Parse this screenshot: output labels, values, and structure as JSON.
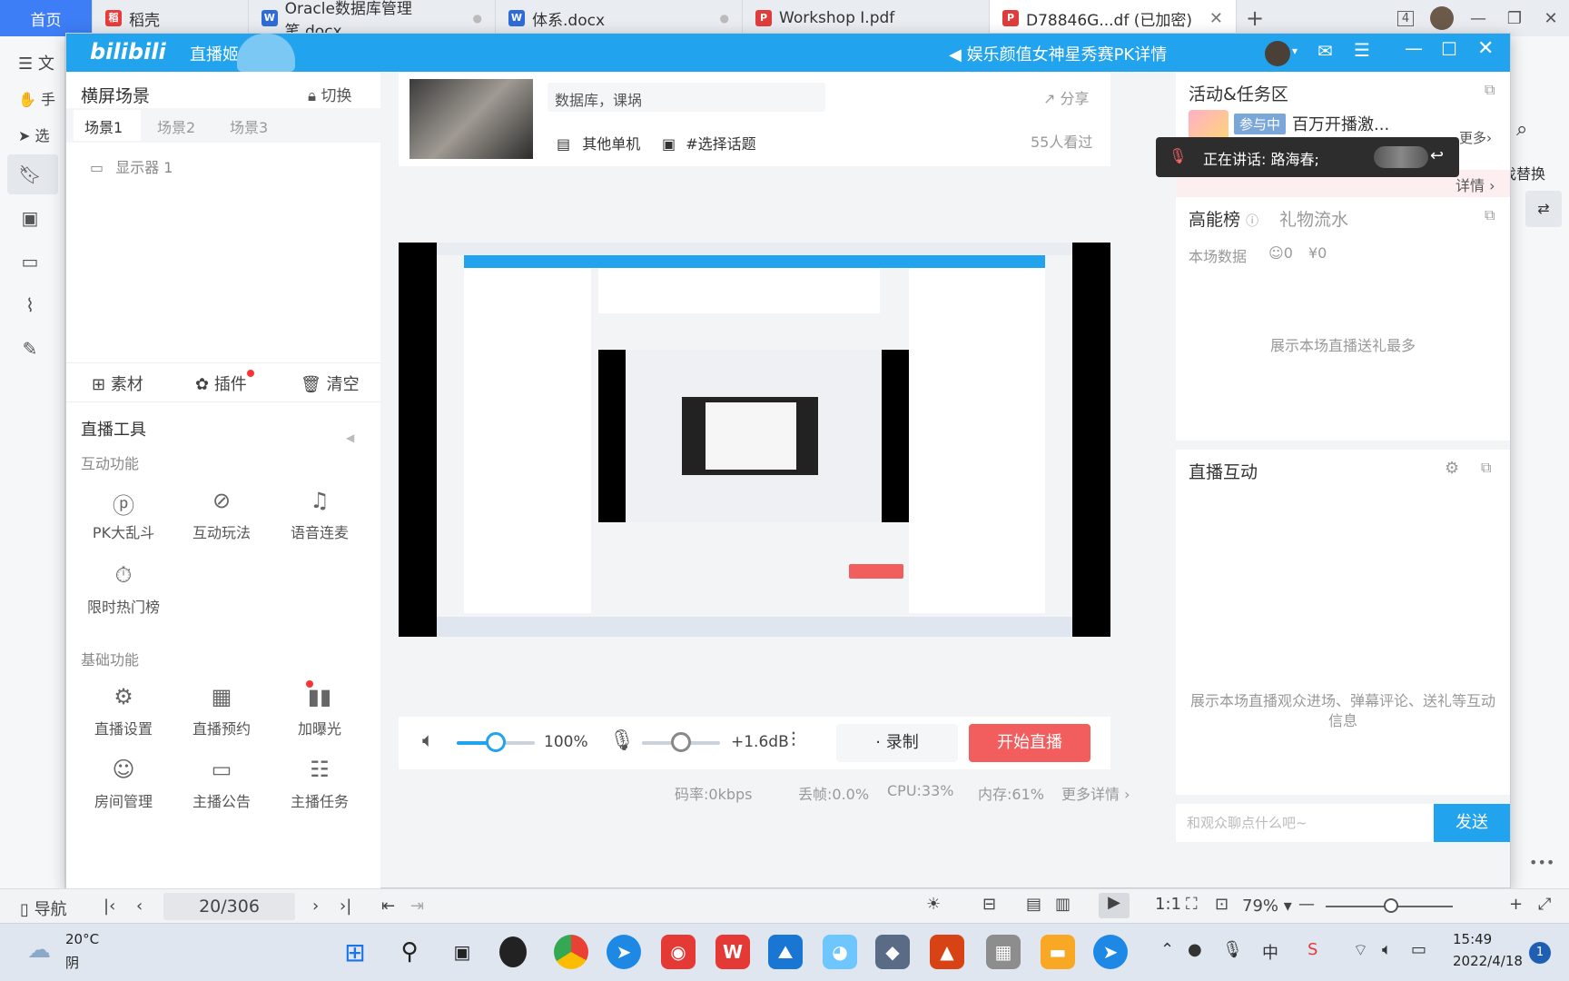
{
  "tabs": {
    "home": "首页",
    "items": [
      {
        "label": "稻壳",
        "icon": "daoke-icon",
        "color": "#e63c3c"
      },
      {
        "label": "Oracle数据库管理笔.docx",
        "icon": "word-icon",
        "color": "#2f6bd8"
      },
      {
        "label": "体系.docx",
        "icon": "word-icon",
        "color": "#2f6bd8"
      },
      {
        "label": "Workshop I.pdf",
        "icon": "pdf-icon",
        "color": "#e03c3c"
      },
      {
        "label": "D78846G...df (已加密)",
        "icon": "pdf-icon",
        "color": "#e03c3c"
      }
    ],
    "add": "+",
    "count_badge": "4"
  },
  "wps_left": {
    "menu": "文",
    "hand": "手",
    "select": "选",
    "replace": "找替换"
  },
  "bili": {
    "logo": "bilibili",
    "app_name": "直播姬",
    "announcement": "娱乐颜值女神星秀赛PK详情",
    "scene_panel": {
      "title": "横屏场景",
      "switch_label": "切换",
      "scenes": [
        "场景1",
        "场景2",
        "场景3"
      ],
      "source": "显示器 1",
      "actions": {
        "material": "素材",
        "plugin": "插件",
        "clear": "清空"
      }
    },
    "tools": {
      "title": "直播工具",
      "interactive_heading": "互动功能",
      "interactive": [
        "PK大乱斗",
        "互动玩法",
        "语音连麦",
        "限时热门榜"
      ],
      "basic_heading": "基础功能",
      "basic": [
        "直播设置",
        "直播预约",
        "加曝光",
        "房间管理",
        "主播公告",
        "主播任务"
      ]
    },
    "room": {
      "title": "数据库，课埚",
      "category": "其他单机",
      "topic": "#选择话题",
      "share": "分享",
      "viewers": "55人看过"
    },
    "controls": {
      "volume": "100%",
      "volume_level": 0.5,
      "mic": "+1.6dB",
      "mic_level": 0.5,
      "record": "录制",
      "start": "开始直播"
    },
    "stats": {
      "bitrate": "码率:0kbps",
      "drop": "丢帧:0.0%",
      "cpu": "CPU:33%",
      "mem": "内存:61%",
      "more": "更多详情"
    },
    "right": {
      "activity_title": "活动&任务区",
      "badge": "参与中",
      "activity_text": "百万开播激...",
      "more": "更多",
      "detail": "详情",
      "speaking": "正在讲话: 路海春;",
      "rank_title": "高能榜",
      "gift_flow": "礼物流水",
      "session_data": "本场数据",
      "viewers": "0",
      "income": "¥0",
      "rank_empty": "展示本场直播送礼最多",
      "interact_title": "直播互动",
      "interact_empty": "展示本场直播观众进场、弹幕评论、送礼等互动信息",
      "chat_placeholder": "和观众聊点什么吧~",
      "send": "发送"
    }
  },
  "status": {
    "nav": "导航",
    "page": "20/306",
    "zoom": "79%"
  },
  "taskbar": {
    "weather_temp": "20°C",
    "weather_desc": "阴",
    "time": "15:49",
    "date": "2022/4/18",
    "notif": "1"
  }
}
